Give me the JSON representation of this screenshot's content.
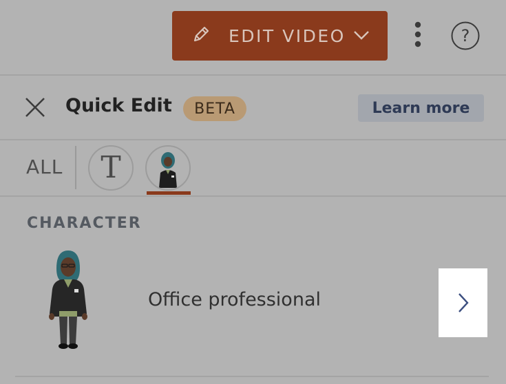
{
  "toolbar": {
    "edit_video_label": "EDIT VIDEO",
    "edit_icon": "pencil-icon",
    "dropdown_icon": "chevron-down-icon",
    "more_icon": "more-vertical-icon",
    "help_icon": "help-icon",
    "help_glyph": "?"
  },
  "panel": {
    "title": "Quick Edit",
    "badge": "BETA",
    "learn_more_label": "Learn more",
    "close_icon": "close-icon"
  },
  "filters": {
    "all_label": "ALL",
    "items": [
      {
        "icon": "text-icon",
        "glyph": "T",
        "active": false
      },
      {
        "icon": "character-icon",
        "active": true
      }
    ]
  },
  "section": {
    "heading": "CHARACTER",
    "item": {
      "name": "Office professional",
      "arrow_icon": "chevron-right-icon"
    }
  },
  "colors": {
    "background": "#b3b3b3",
    "accent": "#8a3a1c",
    "badge": "#b99a74",
    "learn_more_bg": "#a2a6ad",
    "learn_more_text": "#2e3a55"
  }
}
